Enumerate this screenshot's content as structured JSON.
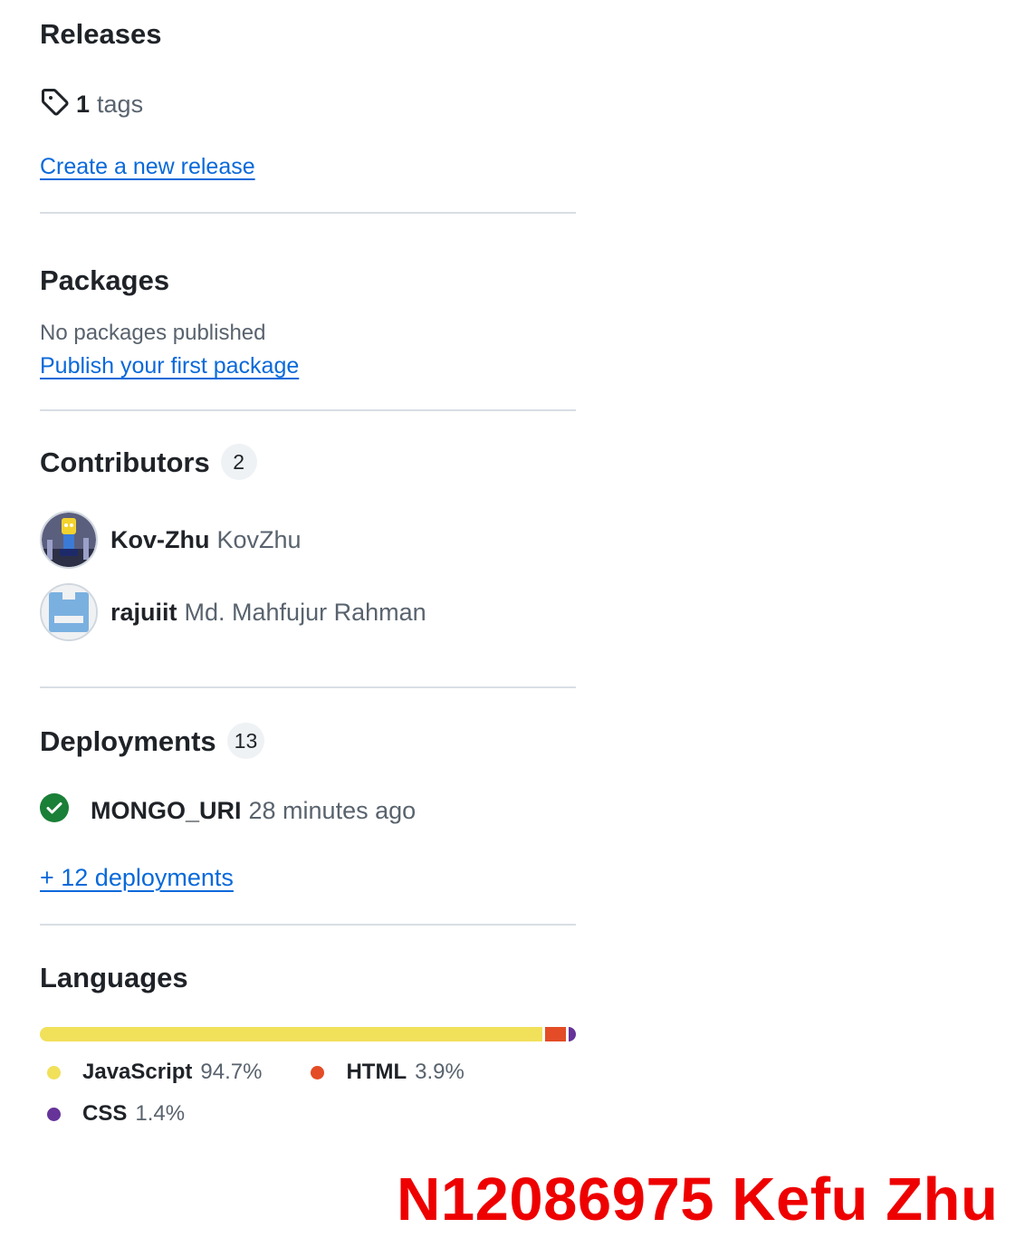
{
  "releases": {
    "title": "Releases",
    "tag_count": "1",
    "tag_label": "tags",
    "create_link": "Create a new release"
  },
  "packages": {
    "title": "Packages",
    "empty_note": "No packages published",
    "publish_link": "Publish your first package"
  },
  "contributors": {
    "title": "Contributors",
    "count": "2",
    "items": [
      {
        "login": "Kov-Zhu",
        "name": "KovZhu"
      },
      {
        "login": "rajuiit",
        "name": "Md. Mahfujur Rahman"
      }
    ]
  },
  "deployments": {
    "title": "Deployments",
    "count": "13",
    "latest": {
      "environment": "MONGO_URI",
      "time": "28 minutes ago",
      "status_icon": "check-circle-icon",
      "status_color": "#1a7f37"
    },
    "more_link": "+ 12 deployments"
  },
  "languages": {
    "title": "Languages",
    "items": [
      {
        "name": "JavaScript",
        "percent": "94.7%",
        "value": 94.7,
        "color": "#f1e05a"
      },
      {
        "name": "HTML",
        "percent": "3.9%",
        "value": 3.9,
        "color": "#e34c26"
      },
      {
        "name": "CSS",
        "percent": "1.4%",
        "value": 1.4,
        "color": "#663399"
      }
    ]
  },
  "watermark": "N12086975 Kefu Zhu"
}
